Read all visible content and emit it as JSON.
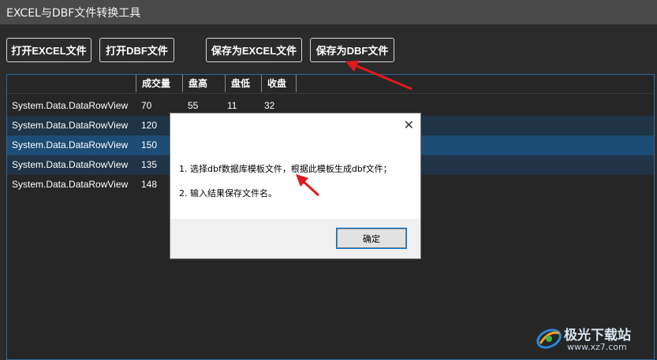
{
  "window": {
    "title": "EXCEL与DBF文件转换工具"
  },
  "toolbar": {
    "open_excel": "打开EXCEL文件",
    "open_dbf": "打开DBF文件",
    "save_excel": "保存为EXCEL文件",
    "save_dbf": "保存为DBF文件"
  },
  "grid": {
    "columns": [
      "",
      "成交量",
      "盘高",
      "盘低",
      "收盘"
    ],
    "rows": [
      [
        "System.Data.DataRowView",
        "70",
        "55",
        "11",
        "32"
      ],
      [
        "System.Data.DataRowView",
        "120",
        "",
        "",
        ""
      ],
      [
        "System.Data.DataRowView",
        "150",
        "",
        "",
        ""
      ],
      [
        "System.Data.DataRowView",
        "135",
        "",
        "",
        ""
      ],
      [
        "System.Data.DataRowView",
        "148",
        "",
        "",
        ""
      ]
    ]
  },
  "dialog": {
    "line1": "1. 选择dbf数据库模板文件，根据此模板生成dbf文件；",
    "line2": "2. 输入结果保存文件名。",
    "ok_label": "确定",
    "close_icon": "close-icon"
  },
  "watermark": {
    "text": "极光下载站",
    "url": "www.xz7.com"
  },
  "colors": {
    "arrow": "#e0191b",
    "selected_row": "#1d4d74",
    "alt_row": "#1f3446"
  }
}
